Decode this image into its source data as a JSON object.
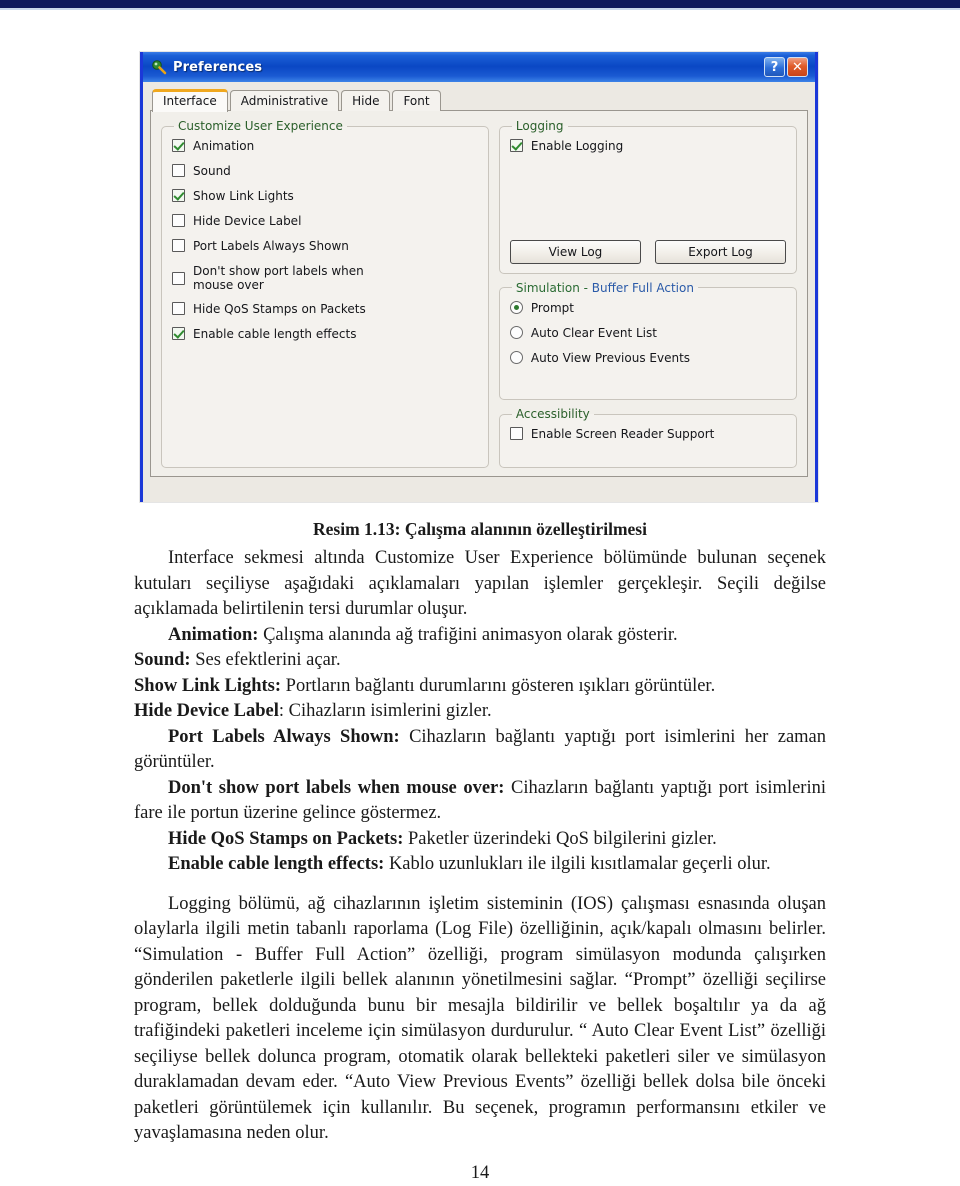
{
  "page": {
    "number": "14"
  },
  "dialog": {
    "title": "Preferences",
    "icon": "preferences-app-icon",
    "window_buttons": [
      {
        "name": "help-button",
        "glyph": "?"
      },
      {
        "name": "close-button",
        "glyph": "✕"
      }
    ],
    "tabs": [
      {
        "label": "Interface",
        "active": true
      },
      {
        "label": "Administrative",
        "active": false
      },
      {
        "label": "Hide",
        "active": false
      },
      {
        "label": "Font",
        "active": false
      }
    ],
    "groups": {
      "customize": {
        "legend": "Customize User Experience",
        "options": [
          {
            "label": "Animation",
            "checked": true
          },
          {
            "label": "Sound",
            "checked": false
          },
          {
            "label": "Show Link Lights",
            "checked": true
          },
          {
            "label": "Hide Device Label",
            "checked": false
          },
          {
            "label": "Port Labels Always Shown",
            "checked": false
          },
          {
            "label": "Don't show port labels when\nmouse over",
            "checked": false
          },
          {
            "label": "Hide QoS Stamps on Packets",
            "checked": false
          },
          {
            "label": "Enable cable length effects",
            "checked": true
          }
        ]
      },
      "logging": {
        "legend": "Logging",
        "options": [
          {
            "label": "Enable Logging",
            "checked": true
          }
        ],
        "buttons": [
          {
            "label": "View Log"
          },
          {
            "label": "Export Log"
          }
        ]
      },
      "simulation": {
        "legend_green": "Simulation - ",
        "legend_blue": "Buffer Full Action",
        "options": [
          {
            "label": "Prompt",
            "checked": true
          },
          {
            "label": "Auto Clear Event List",
            "checked": false
          },
          {
            "label": "Auto View Previous Events",
            "checked": false
          }
        ]
      },
      "accessibility": {
        "legend": "Accessibility",
        "options": [
          {
            "label": "Enable Screen Reader Support",
            "checked": false
          }
        ]
      }
    },
    "colors": {
      "titlebar_blue": "#0a47c4",
      "frame_blue": "#1b38d8",
      "active_tab_accent": "#f0a81e",
      "check_green": "#2f8b30",
      "legend_green": "#2a6b33",
      "legend_blue": "#2a5aa8",
      "close_orange": "#e05c2a",
      "top_rule_navy": "#0e1a5c"
    }
  },
  "document": {
    "caption": "Resim 1.13: Çalışma alanının özelleştirilmesi",
    "intro": "Interface sekmesi altında Customize User Experience bölümünde bulunan seçenek kutuları seçiliyse aşağıdaki açıklamaları yapılan işlemler gerçekleşir. Seçili değilse açıklamada belirtilenin tersi durumlar oluşur.",
    "definitions": [
      {
        "term": "Animation:",
        "text": " Çalışma alanında ağ trafiğini animasyon olarak gösterir."
      },
      {
        "term": "Sound:",
        "text": " Ses efektlerini açar."
      },
      {
        "term": "Show Link Lights:",
        "text": " Portların bağlantı durumlarını gösteren ışıkları görüntüler."
      },
      {
        "term": "Hide Device Label",
        "text": ": Cihazların isimlerini gizler."
      },
      {
        "term": "Port Labels Always Shown:",
        "text": " Cihazların bağlantı yaptığı port isimlerini her zaman görüntüler."
      },
      {
        "term": "Don't show port labels when mouse over:",
        "text": " Cihazların bağlantı yaptığı port isimlerini fare ile portun üzerine gelince göstermez."
      },
      {
        "term": "Hide QoS Stamps on Packets:",
        "text": " Paketler üzerindeki QoS bilgilerini gizler."
      },
      {
        "term": "Enable cable length effects:",
        "text": " Kablo uzunlukları ile ilgili kısıtlamalar geçerli olur."
      }
    ],
    "closing": "Logging bölümü, ağ cihazlarının işletim sisteminin (IOS) çalışması esnasında oluşan olaylarla ilgili metin tabanlı raporlama (Log File) özelliğinin, açık/kapalı olmasını belirler. “Simulation - Buffer Full Action” özelliği, program simülasyon modunda çalışırken gönderilen paketlerle ilgili bellek alanının yönetilmesini sağlar. “Prompt” özelliği seçilirse program, bellek dolduğunda bunu bir mesajla bildirilir ve bellek boşaltılır ya da ağ trafiğindeki paketleri inceleme için simülasyon durdurulur. “ Auto Clear Event List” özelliği seçiliyse bellek dolunca program, otomatik olarak bellekteki paketleri siler ve simülasyon duraklamadan devam eder. “Auto View Previous Events” özelliği bellek dolsa bile önceki paketleri görüntülemek için kullanılır. Bu seçenek, programın performansını etkiler ve yavaşlamasına neden olur."
  }
}
